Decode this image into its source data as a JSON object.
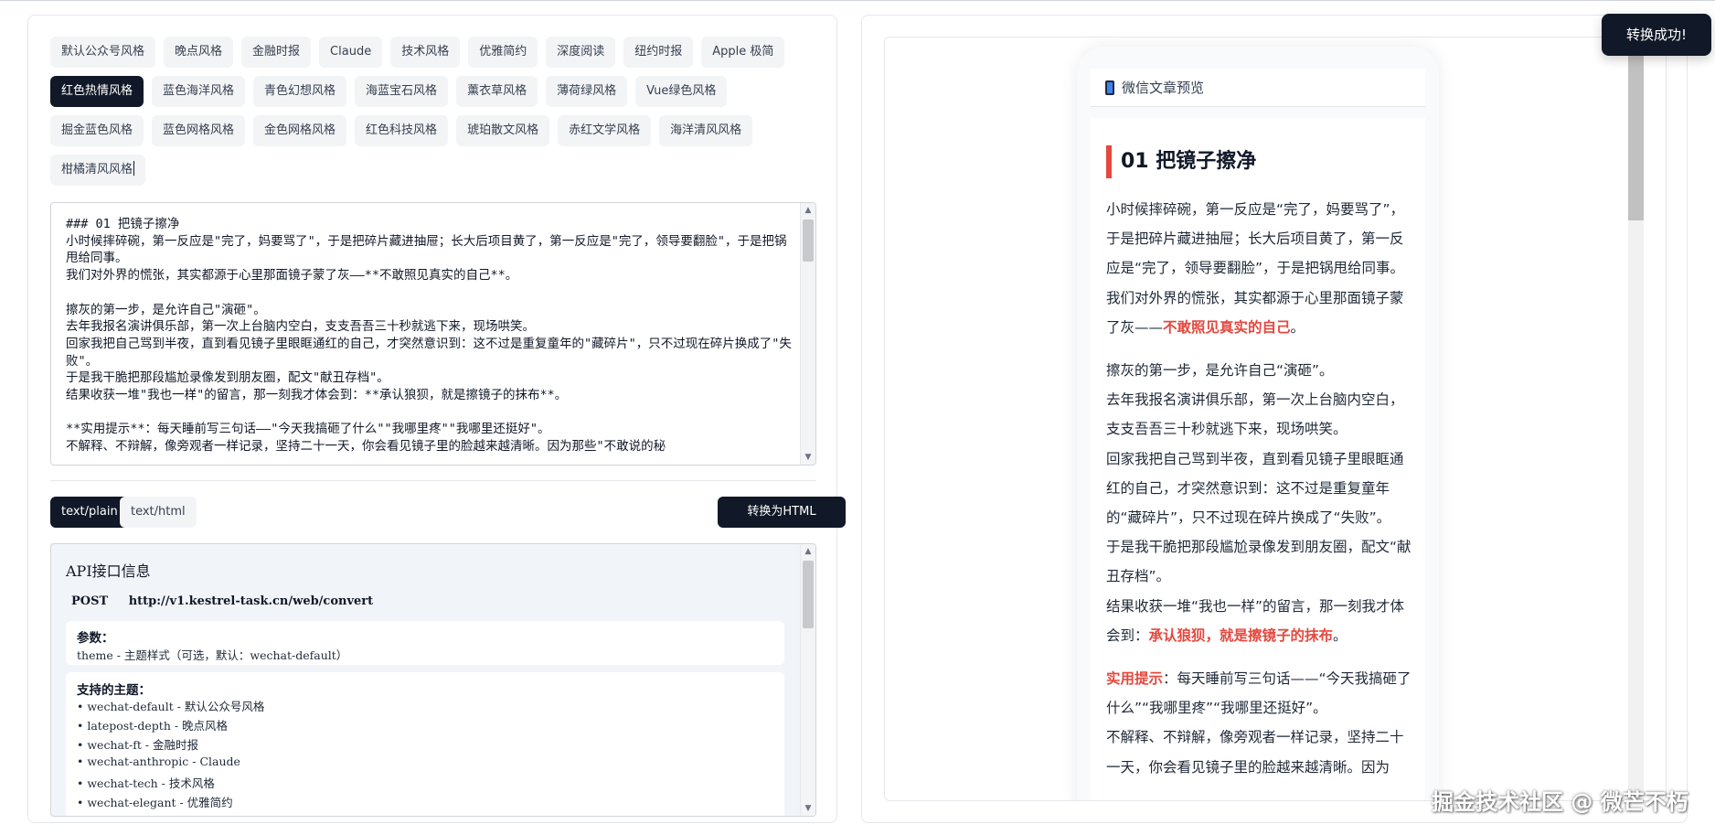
{
  "themes": [
    "默认公众号风格",
    "晚点风格",
    "金融时报",
    "Claude",
    "技术风格",
    "优雅简约",
    "深度阅读",
    "纽约时报",
    "Apple 极简",
    "红色热情风格",
    "蓝色海洋风格",
    "青色幻想风格",
    "海蓝宝石风格",
    "薰衣草风格",
    "薄荷绿风格",
    "Vue绿色风格",
    "掘金蓝色风格",
    "蓝色网格风格",
    "金色网格风格",
    "红色科技风格",
    "琥珀散文风格",
    "赤红文学风格",
    "海洋清风风格",
    "柑橘清风风格"
  ],
  "active_theme_index": 9,
  "editor": {
    "content": "### 01 把镜子擦净\n小时候摔碎碗，第一反应是\"完了，妈要骂了\"，于是把碎片藏进抽屉；长大后项目黄了，第一反应是\"完了，领导要翻脸\"，于是把锅甩给同事。\n我们对外界的慌张，其实都源于心里那面镜子蒙了灰——**不敢照见真实的自己**。\n\n擦灰的第一步，是允许自己\"演砸\"。\n去年我报名演讲俱乐部，第一次上台脑内空白，支支吾吾三十秒就逃下来，现场哄笑。\n回家我把自己骂到半夜，直到看见镜子里眼眶通红的自己，才突然意识到：这不过是重复童年的\"藏碎片\"，只不过现在碎片换成了\"失败\"。\n于是我干脆把那段尴尬录像发到朋友圈，配文\"献丑存档\"。\n结果收获一堆\"我也一样\"的留言，那一刻我才体会到：**承认狼狈，就是擦镜子的抹布**。\n\n**实用提示**：每天睡前写三句话——\"今天我搞砸了什么\"\"我哪里疼\"\"我哪里还挺好\"。\n不解释、不辩解，像旁观者一样记录，坚持二十一天，你会看见镜子里的脸越来越清晰。因为那些\"不敢说的秘"
  },
  "mime_types": [
    "text/plain",
    "text/html"
  ],
  "convert_button": "转换为HTML",
  "api": {
    "title": "API接口信息",
    "method": "POST",
    "url": "http://v1.kestrel-task.cn/web/convert",
    "params_title": "参数：",
    "params_line": "theme - 主题样式（可选，默认：wechat-default）",
    "themes_title": "支持的主题：",
    "theme_lines": [
      "• wechat-default - 默认公众号风格",
      "• latepost-depth - 晚点风格",
      "• wechat-ft - 金融时报",
      "• wechat-anthropic - Claude",
      "• wechat-tech - 技术风格",
      "• wechat-elegant - 优雅简约"
    ]
  },
  "preview": {
    "header": "微信文章预览",
    "heading": "01 把镜子擦净",
    "p1": "小时候摔碎碗，第一反应是“完了，妈要骂了”，于是把碎片藏进抽屉；长大后项目黄了，第一反应是“完了，领导要翻脸”，于是把锅甩给同事。",
    "p2_pre": "我们对外界的慌张，其实都源于心里那面镜子蒙了灰——",
    "p2_hl": "不敢照见真实的自己",
    "p2_post": "。",
    "p3": "擦灰的第一步，是允许自己“演砸”。",
    "p4": "去年我报名演讲俱乐部，第一次上台脑内空白，支支吾吾三十秒就逃下来，现场哄笑。",
    "p5": "回家我把自己骂到半夜，直到看见镜子里眼眶通红的自己，才突然意识到：这不过是重复童年的“藏碎片”，只不过现在碎片换成了“失败”。",
    "p6": "于是我干脆把那段尴尬录像发到朋友圈，配文“献丑存档”。",
    "p7_pre": "结果收获一堆“我也一样”的留言，那一刻我才体会到：",
    "p7_hl": "承认狼狈，就是擦镜子的抹布",
    "p7_post": "。",
    "p8_hl": "实用提示",
    "p8_post": "：每天睡前写三句话——“今天我搞砸了什么”“我哪里疼”“我哪里还挺好”。",
    "p9": "不解释、不辩解，像旁观者一样记录，坚持二十一天，你会看见镜子里的脸越来越清晰。因为"
  },
  "toast": "转换成功!",
  "watermark": "掘金技术社区 @ 微芒不朽",
  "colors": {
    "accent": "#111827",
    "highlight": "#e4483e"
  }
}
